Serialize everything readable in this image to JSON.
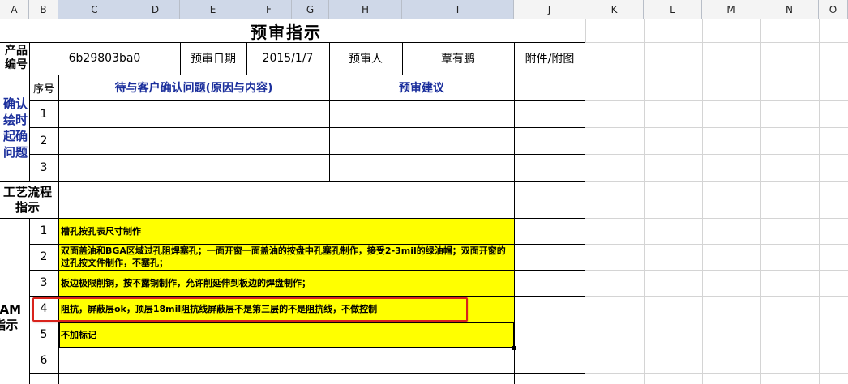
{
  "columns": [
    "A",
    "B",
    "C",
    "D",
    "E",
    "F",
    "G",
    "H",
    "I",
    "J",
    "K",
    "L",
    "M",
    "N",
    "O"
  ],
  "title": "预审指示",
  "header": {
    "product_label_lines": [
      "产品",
      "编号"
    ],
    "product_code": "6b29803ba0",
    "review_date_label": "预审日期",
    "review_date": "2015/1/7",
    "reviewer_label": "预审人",
    "reviewer": "覃有鹏",
    "attachment_label": "附件/附图"
  },
  "confirm_section": {
    "side_label_lines": [
      "确认",
      "绘时",
      "起确",
      "问题"
    ],
    "seq_header": "序号",
    "questions_header": "待与客户确认问题(原因与内容)",
    "suggestions_header": "预审建议",
    "rows": [
      "1",
      "2",
      "3"
    ]
  },
  "process_section": {
    "label_lines": [
      "工艺流程",
      "指示"
    ]
  },
  "cam_section": {
    "side_label_lines": [
      "CAM",
      "指示"
    ],
    "rows": [
      {
        "no": "1",
        "text": "槽孔按孔表尺寸制作"
      },
      {
        "no": "2",
        "text": "双面盖油和BGA区域过孔阻焊塞孔；一面开窗一面盖油的按盘中孔塞孔制作，接受2-3mil的绿油帽；双面开窗的过孔按文件制作，不塞孔；"
      },
      {
        "no": "3",
        "text": "板边极限削铜，按不露铜制作，允许削延伸到板边的焊盘制作；"
      },
      {
        "no": "4",
        "text": "阻抗，屏蔽层ok，顶层18mil阻抗线屏蔽层不是第三层的不是阻抗线，不做控制"
      },
      {
        "no": "5",
        "text": "不加标记"
      },
      {
        "no": "6",
        "text": ""
      }
    ]
  },
  "colors": {
    "instruction_fill": "#ffff00",
    "highlight_border": "#d9231c",
    "header_text": "#1b2f9c"
  }
}
